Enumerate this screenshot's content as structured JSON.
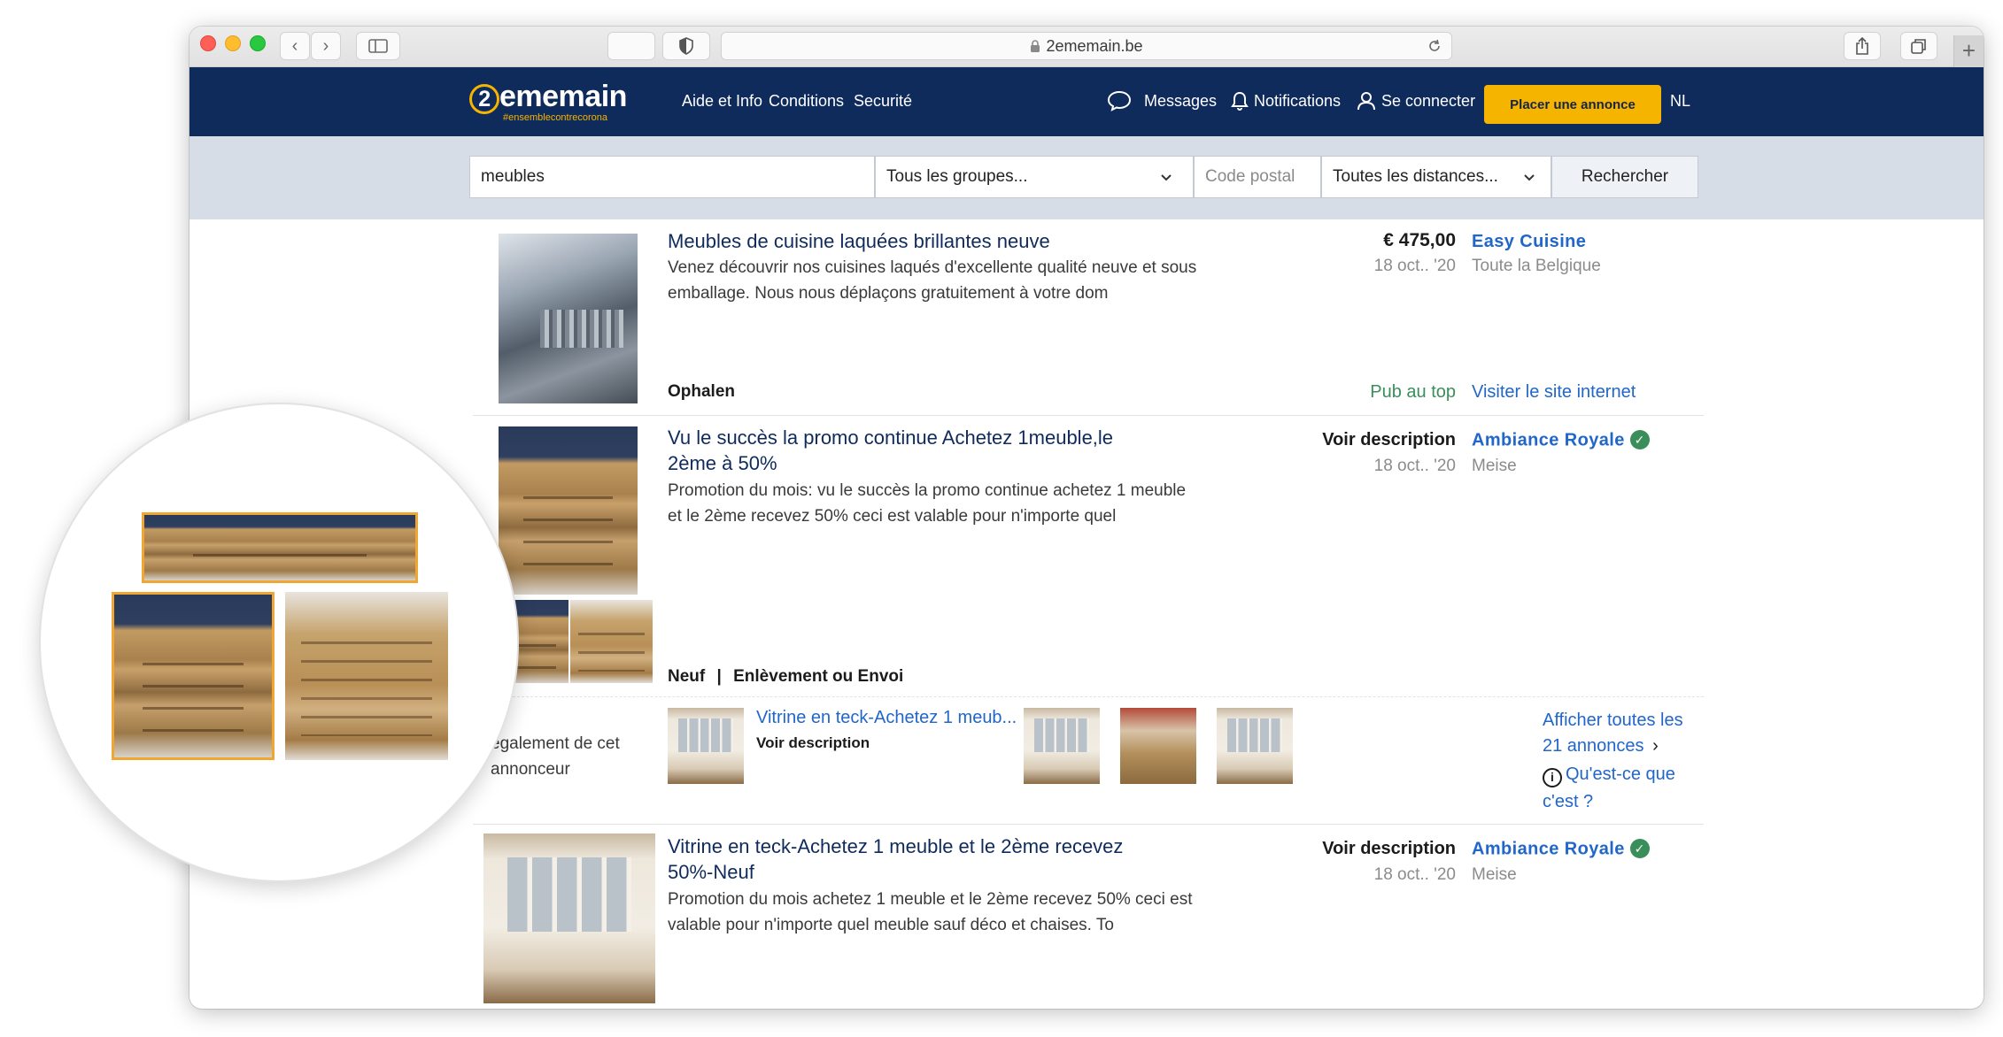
{
  "browser": {
    "url": "2ememain.be"
  },
  "header": {
    "logo": "2ememain",
    "logo_sub": "#ensemblecontrecorona",
    "nav": [
      "Aide et Info",
      "Conditions",
      "Securité"
    ],
    "messages": "Messages",
    "notifications": "Notifications",
    "login": "Se connecter",
    "place_ad": "Placer une annonce",
    "lang": "NL"
  },
  "search": {
    "query": "meubles",
    "group": "Tous les groupes...",
    "postal_placeholder": "Code postal",
    "distance": "Toutes les distances...",
    "button": "Rechercher"
  },
  "listings": [
    {
      "title": "Meubles de cuisine laquées brillantes neuve",
      "description": "Venez découvrir nos cuisines laqués d'excellente qualité neuve et sous emballage. Nous nous déplaçons gratuitement à votre dom",
      "price": "€ 475,00",
      "date": "18 oct.. '20",
      "seller": "Easy Cuisine",
      "location": "Toute la Belgique",
      "meta": "Ophalen",
      "tag": "Pub au top",
      "site_link": "Visiter le site internet"
    },
    {
      "title": "Vu le succès la promo continue Achetez 1meuble,le 2ème à 50%",
      "description": "Promotion du mois: vu le succès la promo continue achetez 1 meuble et le 2ème recevez 50% ceci est valable pour n'importe quel",
      "price": "Voir description",
      "date": "18 oct.. '20",
      "seller": "Ambiance Royale",
      "location": "Meise",
      "meta_condition": "Neuf",
      "meta_sep": "|",
      "meta_delivery": "Enlèvement ou Envoi"
    },
    {
      "title": "Vitrine en teck-Achetez 1 meuble et le 2ème recevez 50%-Neuf",
      "description": "Promotion du mois achetez 1 meuble et le 2ème recevez 50% ceci est valable pour n'importe quel meuble sauf déco et chaises. To",
      "price": "Voir description",
      "date": "18 oct.. '20",
      "seller": "Ambiance Royale",
      "location": "Meise"
    }
  ],
  "advertiser_strip": {
    "label": "également de cet annonceur",
    "item_title": "Vitrine en teck-Achetez 1 meub...",
    "item_price": "Voir description",
    "show_all": "Afficher toutes les 21 annonces",
    "show_all_arrow": "›",
    "whats_this": "Qu'est-ce que c'est ?"
  }
}
